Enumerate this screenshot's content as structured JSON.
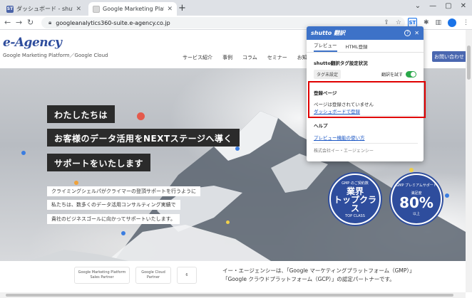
{
  "browser": {
    "tabs": [
      {
        "label": "ダッシュボード - shutto翻訳",
        "favicon": "ST"
      },
      {
        "label": "Google Marketing Platform, Goo",
        "favicon": ""
      }
    ],
    "url": "googleanalytics360-suite.e-agency.co.jp"
  },
  "site": {
    "logo": "e-Agency",
    "logo_sub": "Google Marketing Platform／Google Cloud",
    "nav": [
      "サービス紹介",
      "事例",
      "コラム",
      "セミナー",
      "お知"
    ],
    "contact_label": "お問い合わせ"
  },
  "hero": {
    "headlines": [
      "わたしたちは",
      "お客様のデータ活用をNEXTステージへ導く",
      "サポートをいたします"
    ],
    "sublines": [
      "クライミングシェルパがクライマーの登頂サポートを行うように",
      "私たちは、数多くのデータ活用コンサルティング実績で",
      "貴社のビジネスゴールに向かってサポートいたします。"
    ],
    "badge1": {
      "top": "GMP のご契約数",
      "main1": "業界",
      "main2": "トップクラス",
      "sub": "TOP CLASS"
    },
    "badge2": {
      "top": "GMP プレミアムサポート",
      "main1": "満足度",
      "main2": "80%",
      "sub": "以上"
    }
  },
  "partners": {
    "logos": [
      "Google Marketing Platform Sales Partner",
      "Google Cloud Partner",
      "6"
    ],
    "text1": "イー・エージェンシーは、「Google マーケティングプラットフォーム（GMP）」",
    "text2": "「Google クラウドプラットフォーム（GCP）」の認定パートナーです。"
  },
  "popup": {
    "brand": "shutto 翻訳",
    "tabs": [
      "プレビュー",
      "HTML登録"
    ],
    "status_title": "shutto翻訳タグ設定状況",
    "tag_pill": "タグ未設定",
    "toggle_label": "翻訳を試す",
    "toggle_on": true,
    "reg_title": "登録ページ",
    "reg_text": "ページは登録されていません",
    "reg_link": "ダッシュボードで登録",
    "help_title": "ヘルプ",
    "help_link": "プレビュー機能の使い方",
    "footer": "株式会社イー・エージェンシー"
  },
  "colors": {
    "brand": "#2e4d9d",
    "popup_header": "#3d72c8",
    "highlight": "#e00000",
    "toggle_on": "#2aa84a"
  }
}
